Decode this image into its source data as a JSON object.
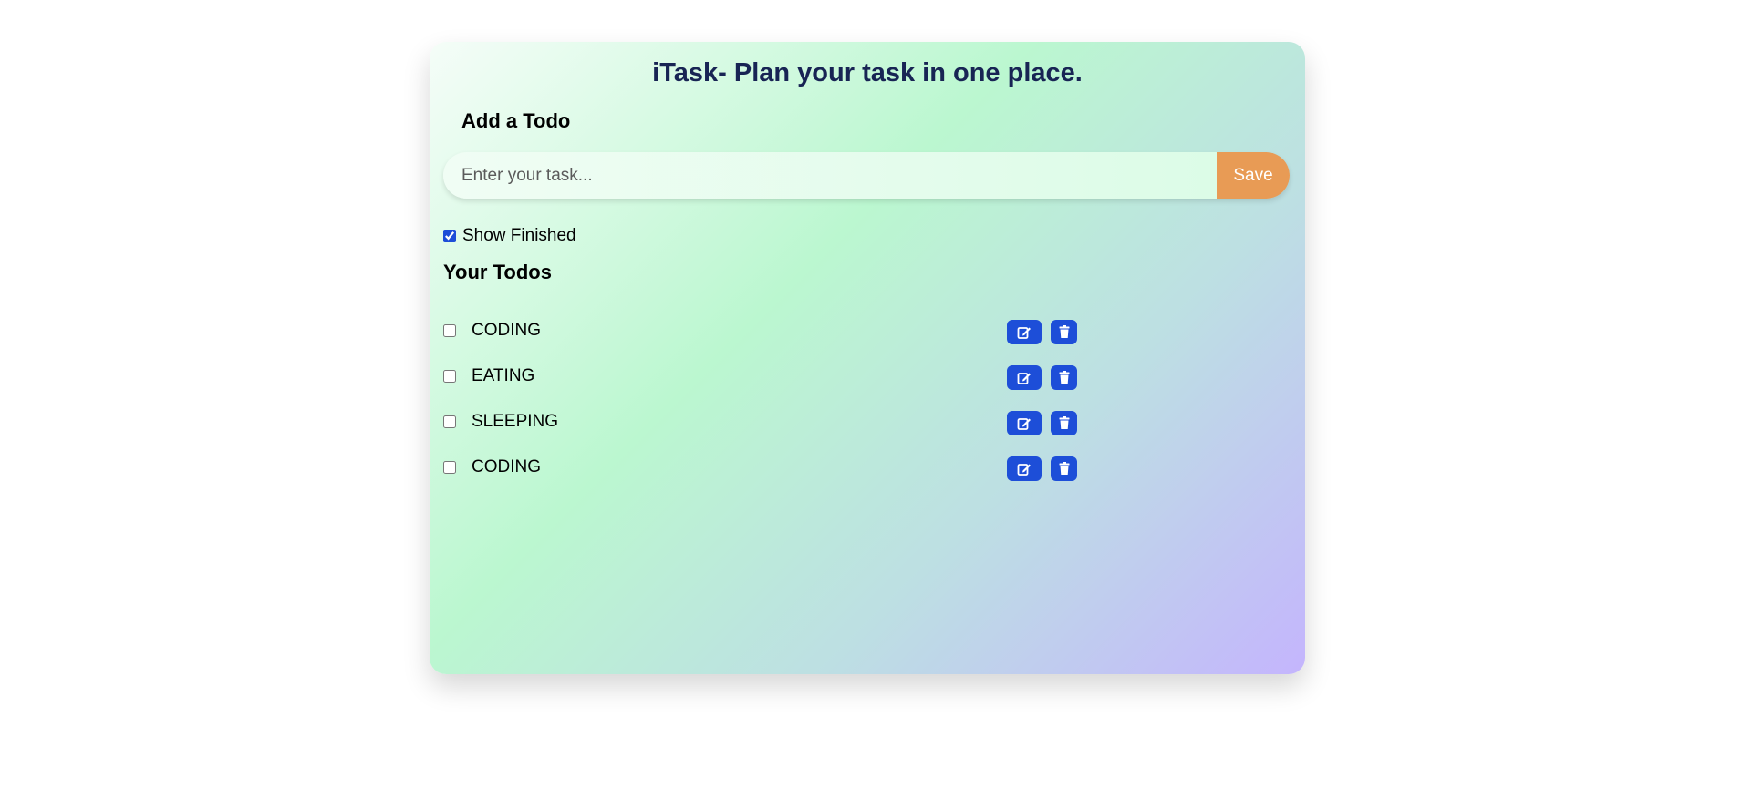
{
  "header": {
    "title": "iTask- Plan your task in one place."
  },
  "add_todo": {
    "heading": "Add a Todo",
    "input_placeholder": "Enter your task...",
    "input_value": "",
    "save_label": "Save"
  },
  "filter": {
    "show_finished_label": "Show Finished",
    "show_finished_checked": true
  },
  "todos": {
    "heading": "Your Todos",
    "items": [
      {
        "text": "CODING",
        "done": false
      },
      {
        "text": "EATING",
        "done": false
      },
      {
        "text": "SLEEPING",
        "done": false
      },
      {
        "text": "CODING",
        "done": false
      }
    ]
  },
  "icons": {
    "edit": "edit-icon",
    "delete": "trash-icon"
  },
  "colors": {
    "title": "#182454",
    "save_button": "#e89b55",
    "action_button": "#1d4ed8",
    "gradient_start": "#f5fdf8",
    "gradient_mid": "#bbf7d0",
    "gradient_end": "#c4b5fd"
  }
}
